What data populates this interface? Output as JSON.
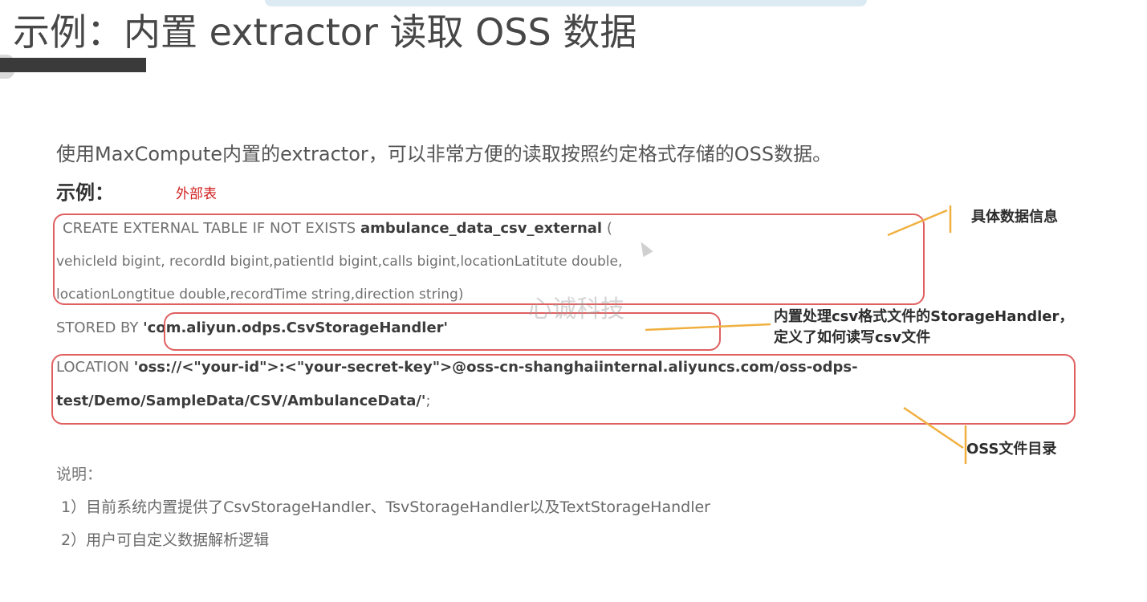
{
  "title": "示例：内置 extractor 读取 OSS 数据",
  "intro": "使用MaxCompute内置的extractor，可以非常方便的读取按照约定格式存储的OSS数据。",
  "example_label": "示例：",
  "external_table_note": "外部表",
  "code": {
    "line1_prefix": "CREATE EXTERNAL TABLE IF NOT EXISTS ",
    "line1_table": "ambulance_data_csv_external",
    "line1_suffix": " (",
    "line2": "vehicleId bigint, recordId bigint,patientId bigint,calls bigint,locationLatitute double,",
    "line3": "locationLongtitue double,recordTime string,direction string)",
    "stored_prefix": "STORED BY ",
    "stored_value": "'com.aliyun.odps.CsvStorageHandler'",
    "location_prefix": "LOCATION ",
    "location_value_1": "'oss://<\"your-id\">:<\"your-secret-key\">@oss-cn-shanghaiinternal.aliyuncs.com/oss-odps-",
    "location_value_2": "test/Demo/SampleData/CSV/AmbulanceData/'",
    "location_suffix": ";"
  },
  "callouts": {
    "data_info": "具体数据信息",
    "storage_handler_1": "内置处理csv格式文件的StorageHandler，",
    "storage_handler_2": "定义了如何读写csv文件",
    "oss_dir": "OSS文件目录"
  },
  "watermark": "心诚科技",
  "notes": {
    "title": "说明：",
    "items": [
      "1）目前系统内置提供了CsvStorageHandler、TsvStorageHandler以及TextStorageHandler",
      "2）用户可自定义数据解析逻辑"
    ]
  },
  "colors": {
    "box_border": "#e06060",
    "callout_line": "#f0b040",
    "note_red": "#d21f1f"
  }
}
